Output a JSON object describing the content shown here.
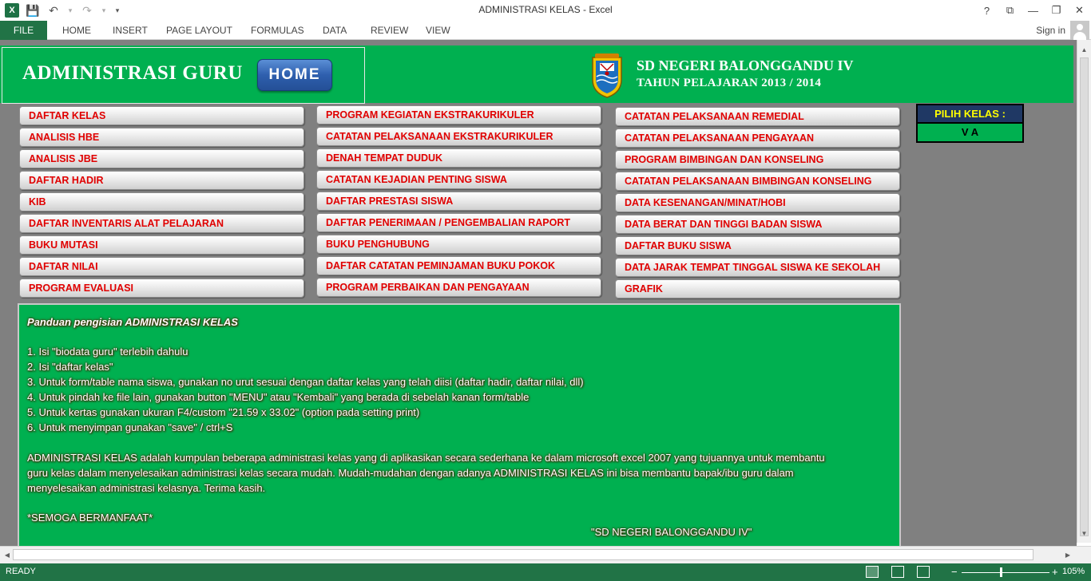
{
  "window": {
    "title": "ADMINISTRASI KELAS - Excel",
    "app_icon": "X",
    "controls": {
      "help": "?",
      "ribbon_display": "⧉",
      "minimize": "—",
      "restore": "❐",
      "close": "✕"
    }
  },
  "qat": {
    "save": "💾",
    "undo": "↶",
    "undo_drop": "▾",
    "redo": "↷",
    "redo_drop": "▾",
    "customize": "▾"
  },
  "ribbon": {
    "tabs": [
      "FILE",
      "HOME",
      "INSERT",
      "PAGE LAYOUT",
      "FORMULAS",
      "DATA",
      "REVIEW",
      "VIEW"
    ],
    "signin": "Sign in"
  },
  "header": {
    "admin_title": "ADMINISTRASI GURU",
    "home_button": "HOME",
    "school_name": "SD NEGERI BALONGGANDU IV",
    "school_year": "TAHUN PELAJARAN 2013 / 2014"
  },
  "menu": {
    "col1": [
      "DAFTAR KELAS",
      "ANALISIS HBE",
      "ANALISIS JBE",
      "DAFTAR HADIR",
      "KIB",
      "DAFTAR INVENTARIS ALAT PELAJARAN",
      "BUKU MUTASI",
      "DAFTAR NILAI",
      "PROGRAM EVALUASI"
    ],
    "col2": [
      "PROGRAM KEGIATAN EKSTRAKURIKULER",
      "CATATAN PELAKSANAAN EKSTRAKURIKULER",
      "DENAH TEMPAT DUDUK",
      "CATATAN KEJADIAN PENTING SISWA",
      "DAFTAR PRESTASI SISWA",
      "DAFTAR PENERIMAAN / PENGEMBALIAN RAPORT",
      "BUKU PENGHUBUNG",
      "DAFTAR CATATAN PEMINJAMAN BUKU POKOK",
      "PROGRAM PERBAIKAN DAN PENGAYAAN"
    ],
    "col3": [
      "CATATAN PELAKSANAAN REMEDIAL",
      "CATATAN PELAKSANAAN PENGAYAAN",
      "PROGRAM BIMBINGAN DAN KONSELING",
      "CATATAN PELAKSANAAN BIMBINGAN KONSELING",
      "DATA KESENANGAN/MINAT/HOBI",
      "DATA BERAT DAN TINGGI BADAN SISWA",
      "DAFTAR BUKU SISWA",
      "DATA JARAK TEMPAT TINGGAL SISWA KE SEKOLAH",
      "GRAFIK"
    ]
  },
  "pilih_kelas": {
    "label": "PILIH KELAS :",
    "value": "V A"
  },
  "guide": {
    "title": "Panduan pengisian ADMINISTRASI KELAS",
    "steps": [
      "1. Isi \"biodata guru\" terlebih dahulu",
      "2. Isi \"daftar kelas\"",
      "3. Untuk form/table nama siswa, gunakan no urut sesuai dengan daftar kelas yang telah diisi (daftar hadir, daftar nilai, dll)",
      "4. Untuk pindah ke file lain, gunakan button \"MENU\" atau \"Kembali\" yang berada di sebelah kanan form/table",
      "5. Untuk kertas gunakan ukuran F4/custom \"21.59 x 33.02\" (option pada setting print)",
      "6. Untuk menyimpan gunakan \"save\" / ctrl+S"
    ],
    "paragraph": [
      " ADMINISTRASI KELAS adalah kumpulan beberapa administrasi kelas yang di aplikasikan secara sederhana ke dalam microsoft excel 2007 yang tujuannya untuk membantu",
      "guru kelas dalam menyelesaikan administrasi kelas secara mudah. Mudah-mudahan dengan adanya ADMINISTRASI KELAS ini bisa membantu bapak/ibu guru dalam",
      "menyelesaikan administrasi kelasnya. Terima kasih."
    ],
    "closing": "  *SEMOGA BERMANFAAT*",
    "signature": "\"SD NEGERI BALONGGANDU IV\""
  },
  "status": {
    "ready": "READY",
    "zoom": "105%",
    "zoom_minus": "−",
    "zoom_plus": "+"
  },
  "colors": {
    "excel_green": "#217346",
    "sheet_green": "#00b050",
    "menu_text": "#e00000",
    "pilih_bg": "#1f3864",
    "pilih_text": "#ffff00"
  }
}
